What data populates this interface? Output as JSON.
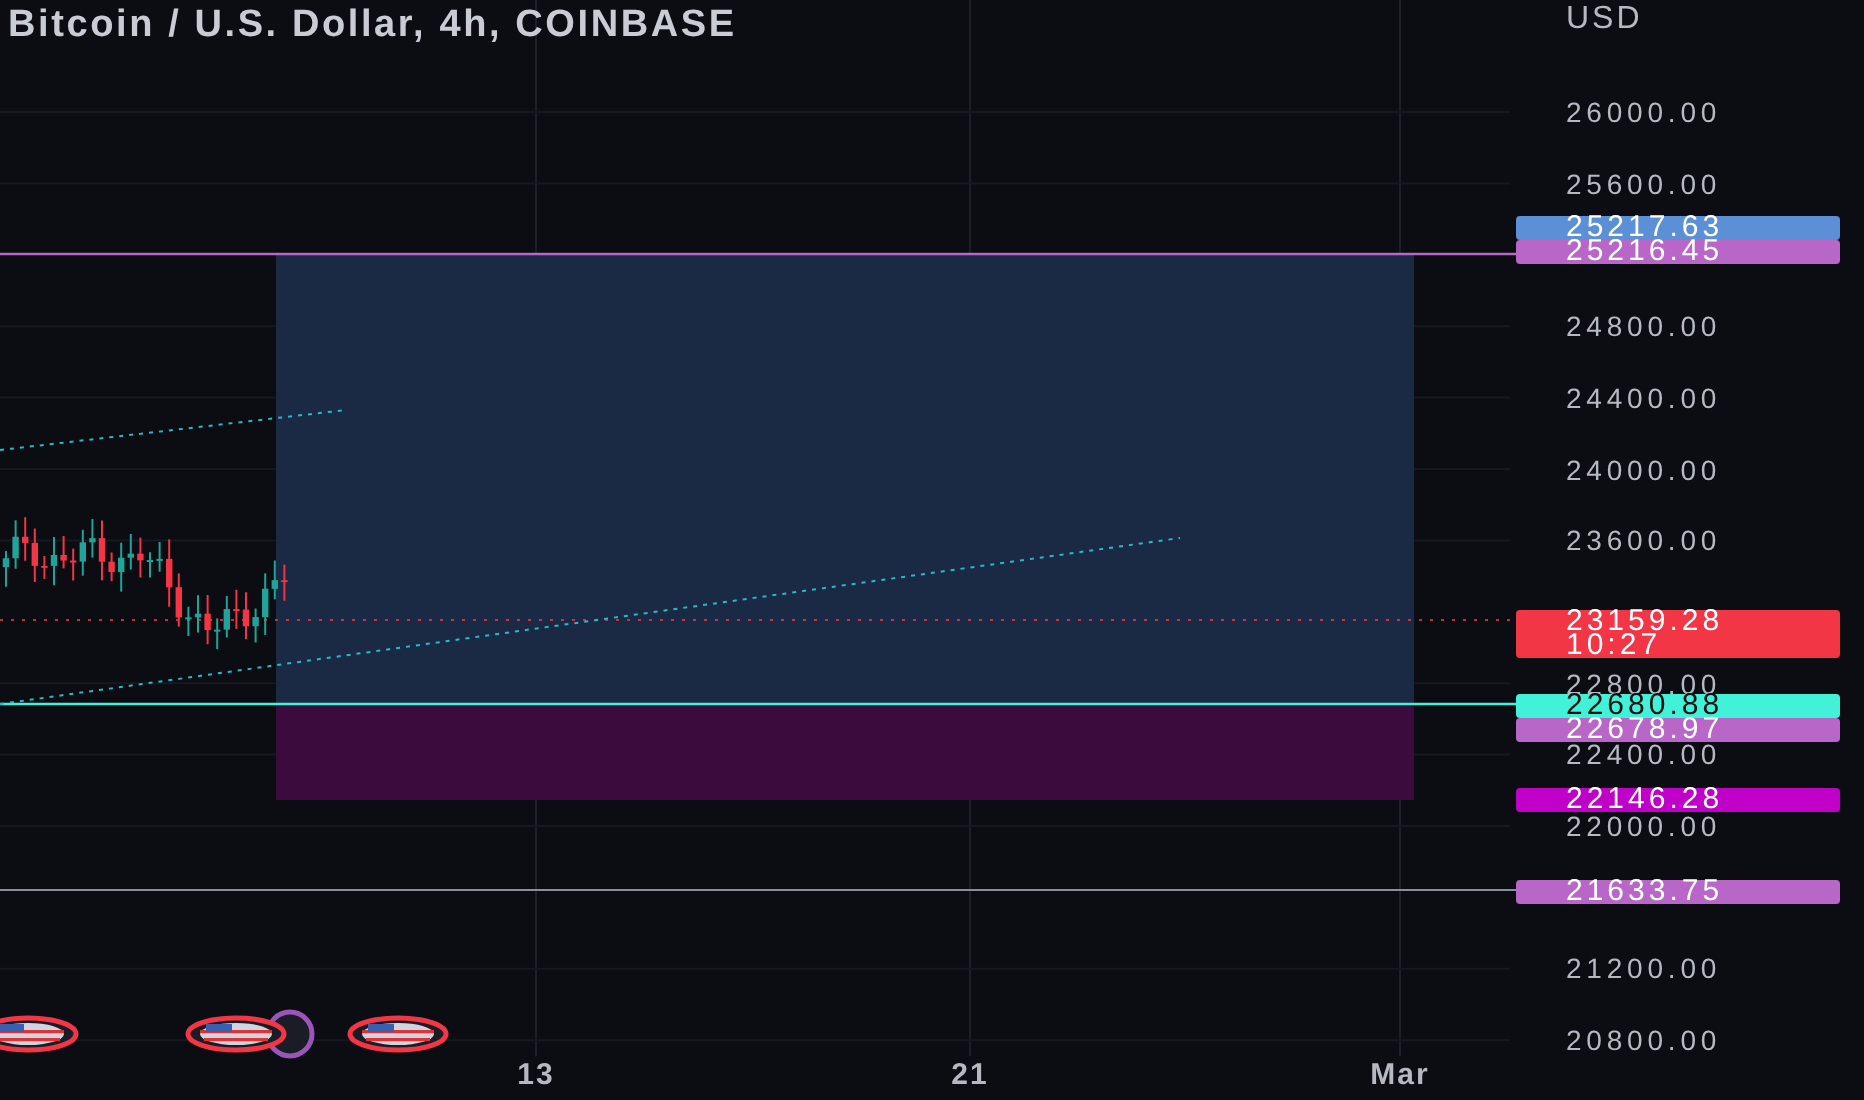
{
  "title": "Bitcoin / U.S. Dollar, 4h, COINBASE",
  "price_axis": {
    "currency": "USD",
    "ticks": [
      "26000.00",
      "25600.00",
      "24800.00",
      "24400.00",
      "24000.00",
      "23600.00",
      "22800.00",
      "22400.00",
      "22000.00",
      "21200.00",
      "20800.00"
    ]
  },
  "price_labels": [
    {
      "value": "25217.63",
      "color": "#5b8fd6"
    },
    {
      "value": "25216.45",
      "color": "#b866c8"
    },
    {
      "value": "23159.28",
      "countdown": "10:27",
      "color": "#f23645"
    },
    {
      "value": "22680.88",
      "color": "#42f2d8"
    },
    {
      "value": "22678.97",
      "color": "#b866c8"
    },
    {
      "value": "22146.28",
      "color": "#c000c8"
    },
    {
      "value": "21633.75",
      "color": "#b866c8"
    }
  ],
  "time_axis": [
    "13",
    "21",
    "Mar"
  ]
}
